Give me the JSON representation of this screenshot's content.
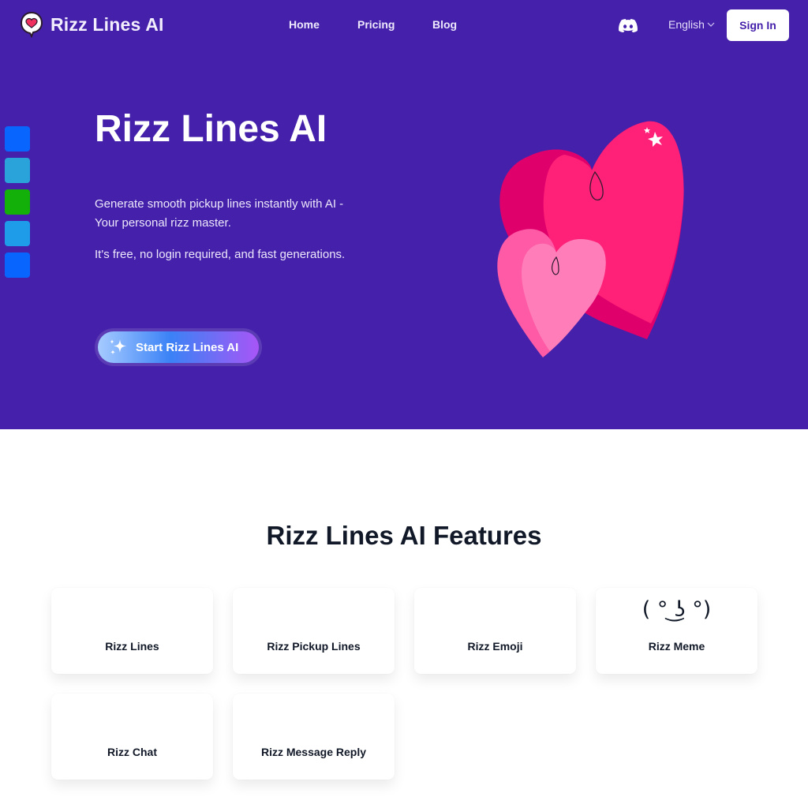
{
  "header": {
    "brand": "Rizz Lines AI",
    "logo_icon": "heart-speech-bubble-icon",
    "nav": [
      {
        "label": "Home"
      },
      {
        "label": "Pricing"
      },
      {
        "label": "Blog"
      }
    ],
    "discord_icon": "discord-icon",
    "language": "English",
    "sign_in": "Sign In"
  },
  "share_bar": {
    "items": [
      {
        "name": "facebook",
        "color": "#0866ff"
      },
      {
        "name": "telegram",
        "color": "#2aa3db"
      },
      {
        "name": "line",
        "color": "#14b00a"
      },
      {
        "name": "twitter",
        "color": "#1e9be9"
      },
      {
        "name": "messenger",
        "color": "#0866ff"
      }
    ]
  },
  "hero": {
    "title": "Rizz Lines AI",
    "description": "Generate smooth pickup lines instantly with AI - Your personal rizz master.",
    "subtext": "It's free, no login required, and fast generations.",
    "cta": "Start Rizz Lines AI",
    "cta_icon": "sparkles-icon",
    "illustration": "hearts-illustration",
    "background": "#4521ab"
  },
  "features": {
    "title": "Rizz Lines AI Features",
    "cards": [
      {
        "label": "Rizz Lines",
        "icon": ""
      },
      {
        "label": "Rizz Pickup Lines",
        "icon": ""
      },
      {
        "label": "Rizz Emoji",
        "icon": ""
      },
      {
        "label": "Rizz Meme",
        "icon": "( ° ͜ʖ °)"
      },
      {
        "label": "Rizz Chat",
        "icon": ""
      },
      {
        "label": "Rizz Message Reply",
        "icon": ""
      }
    ]
  }
}
